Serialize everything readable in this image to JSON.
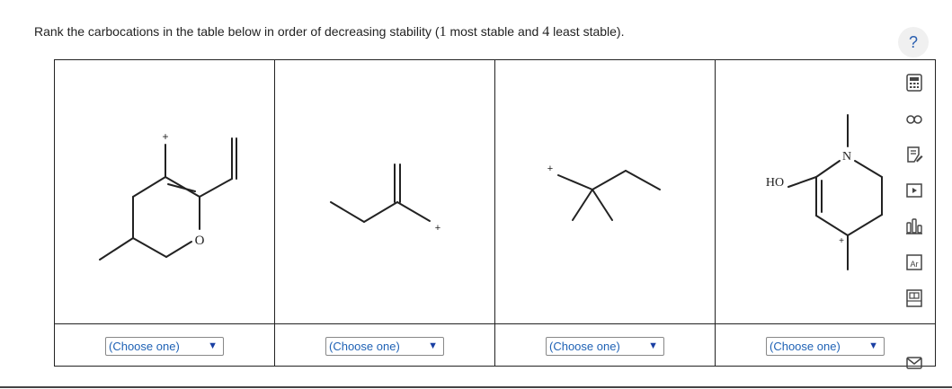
{
  "question": {
    "before": "Rank the carbocations in the table below in order of decreasing stability (",
    "n1": "1",
    "middle": " most stable and ",
    "n4": "4",
    "after": " least stable)."
  },
  "structures": {
    "s1": {
      "charge": "+",
      "oxygen": "O"
    },
    "s2": {
      "charge": "+"
    },
    "s3": {
      "charge": "+"
    },
    "s4": {
      "charge": "+",
      "ho": "HO",
      "nitrogen": "N"
    }
  },
  "selects": [
    {
      "value": "(Choose one)"
    },
    {
      "value": "(Choose one)"
    },
    {
      "value": "(Choose one)"
    },
    {
      "value": "(Choose one)"
    }
  ],
  "toolbar": {
    "help_label": "?",
    "icons": [
      "calculator-icon",
      "glasses-icon",
      "notes-icon",
      "video-icon",
      "chart-icon",
      "periodic-table-icon",
      "data-table-icon",
      "mail-icon"
    ]
  },
  "colors": {
    "select_text": "#1f62b5",
    "arrow": "#1a3fa3",
    "toolbar_icon": "#444444"
  }
}
